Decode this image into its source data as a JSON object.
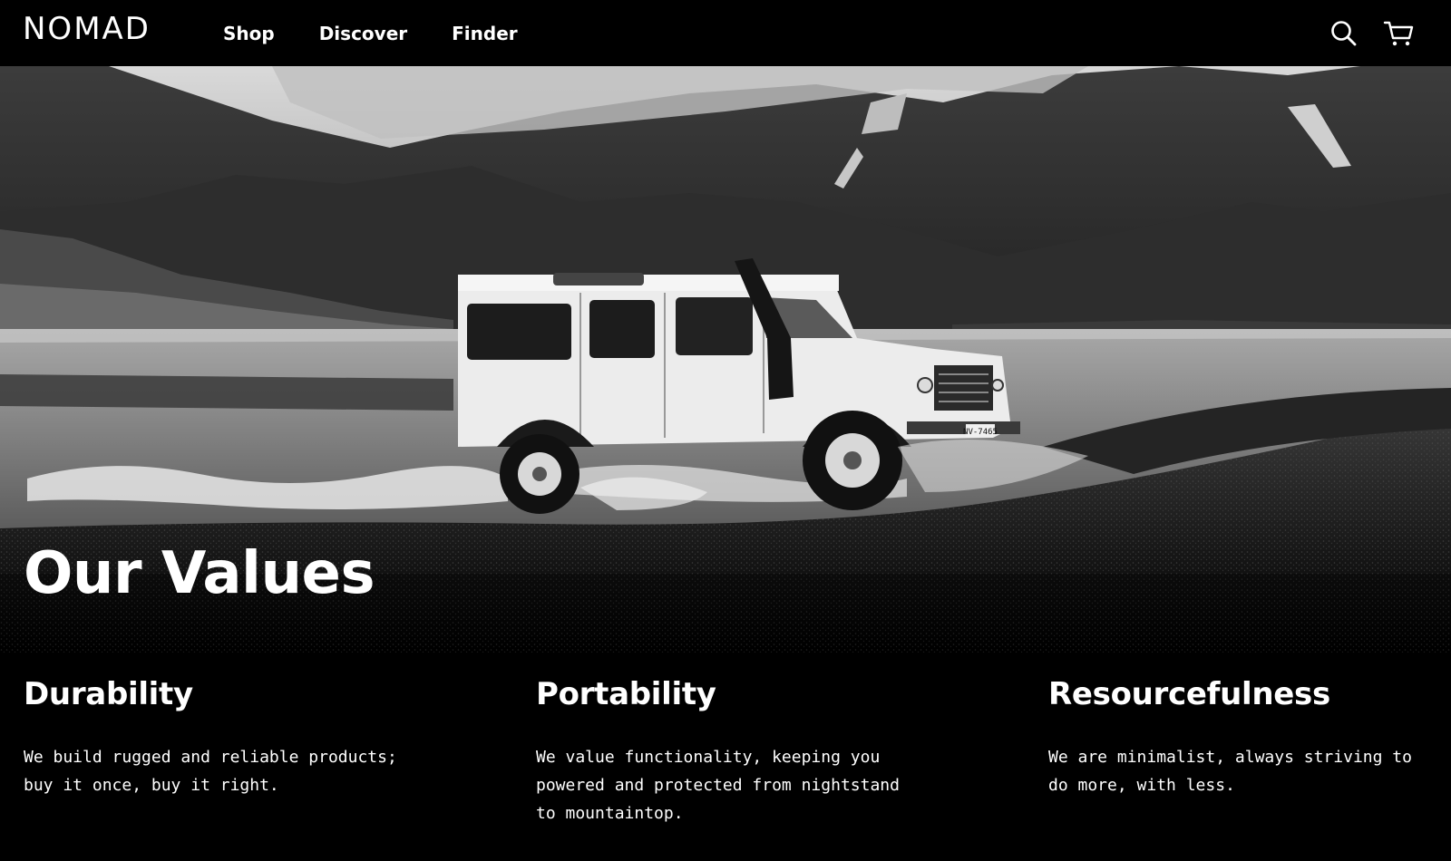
{
  "brand": {
    "logo_text": "NOMAD"
  },
  "nav": {
    "items": [
      {
        "label": "Shop"
      },
      {
        "label": "Discover"
      },
      {
        "label": "Finder"
      }
    ]
  },
  "header_icons": {
    "search": "search-icon",
    "cart": "cart-icon"
  },
  "hero": {
    "title": "Our Values",
    "plate_text": "NV-7465"
  },
  "values": [
    {
      "heading": "Durability",
      "text": "We build rugged and reliable products; buy it once, buy it right."
    },
    {
      "heading": "Portability",
      "text": "We value functionality, keeping you powered and protected from nightstand to mountaintop."
    },
    {
      "heading": "Resourcefulness",
      "text": "We are minimalist, always striving to do more, with less."
    }
  ],
  "colors": {
    "background": "#000000",
    "text": "#ffffff"
  }
}
